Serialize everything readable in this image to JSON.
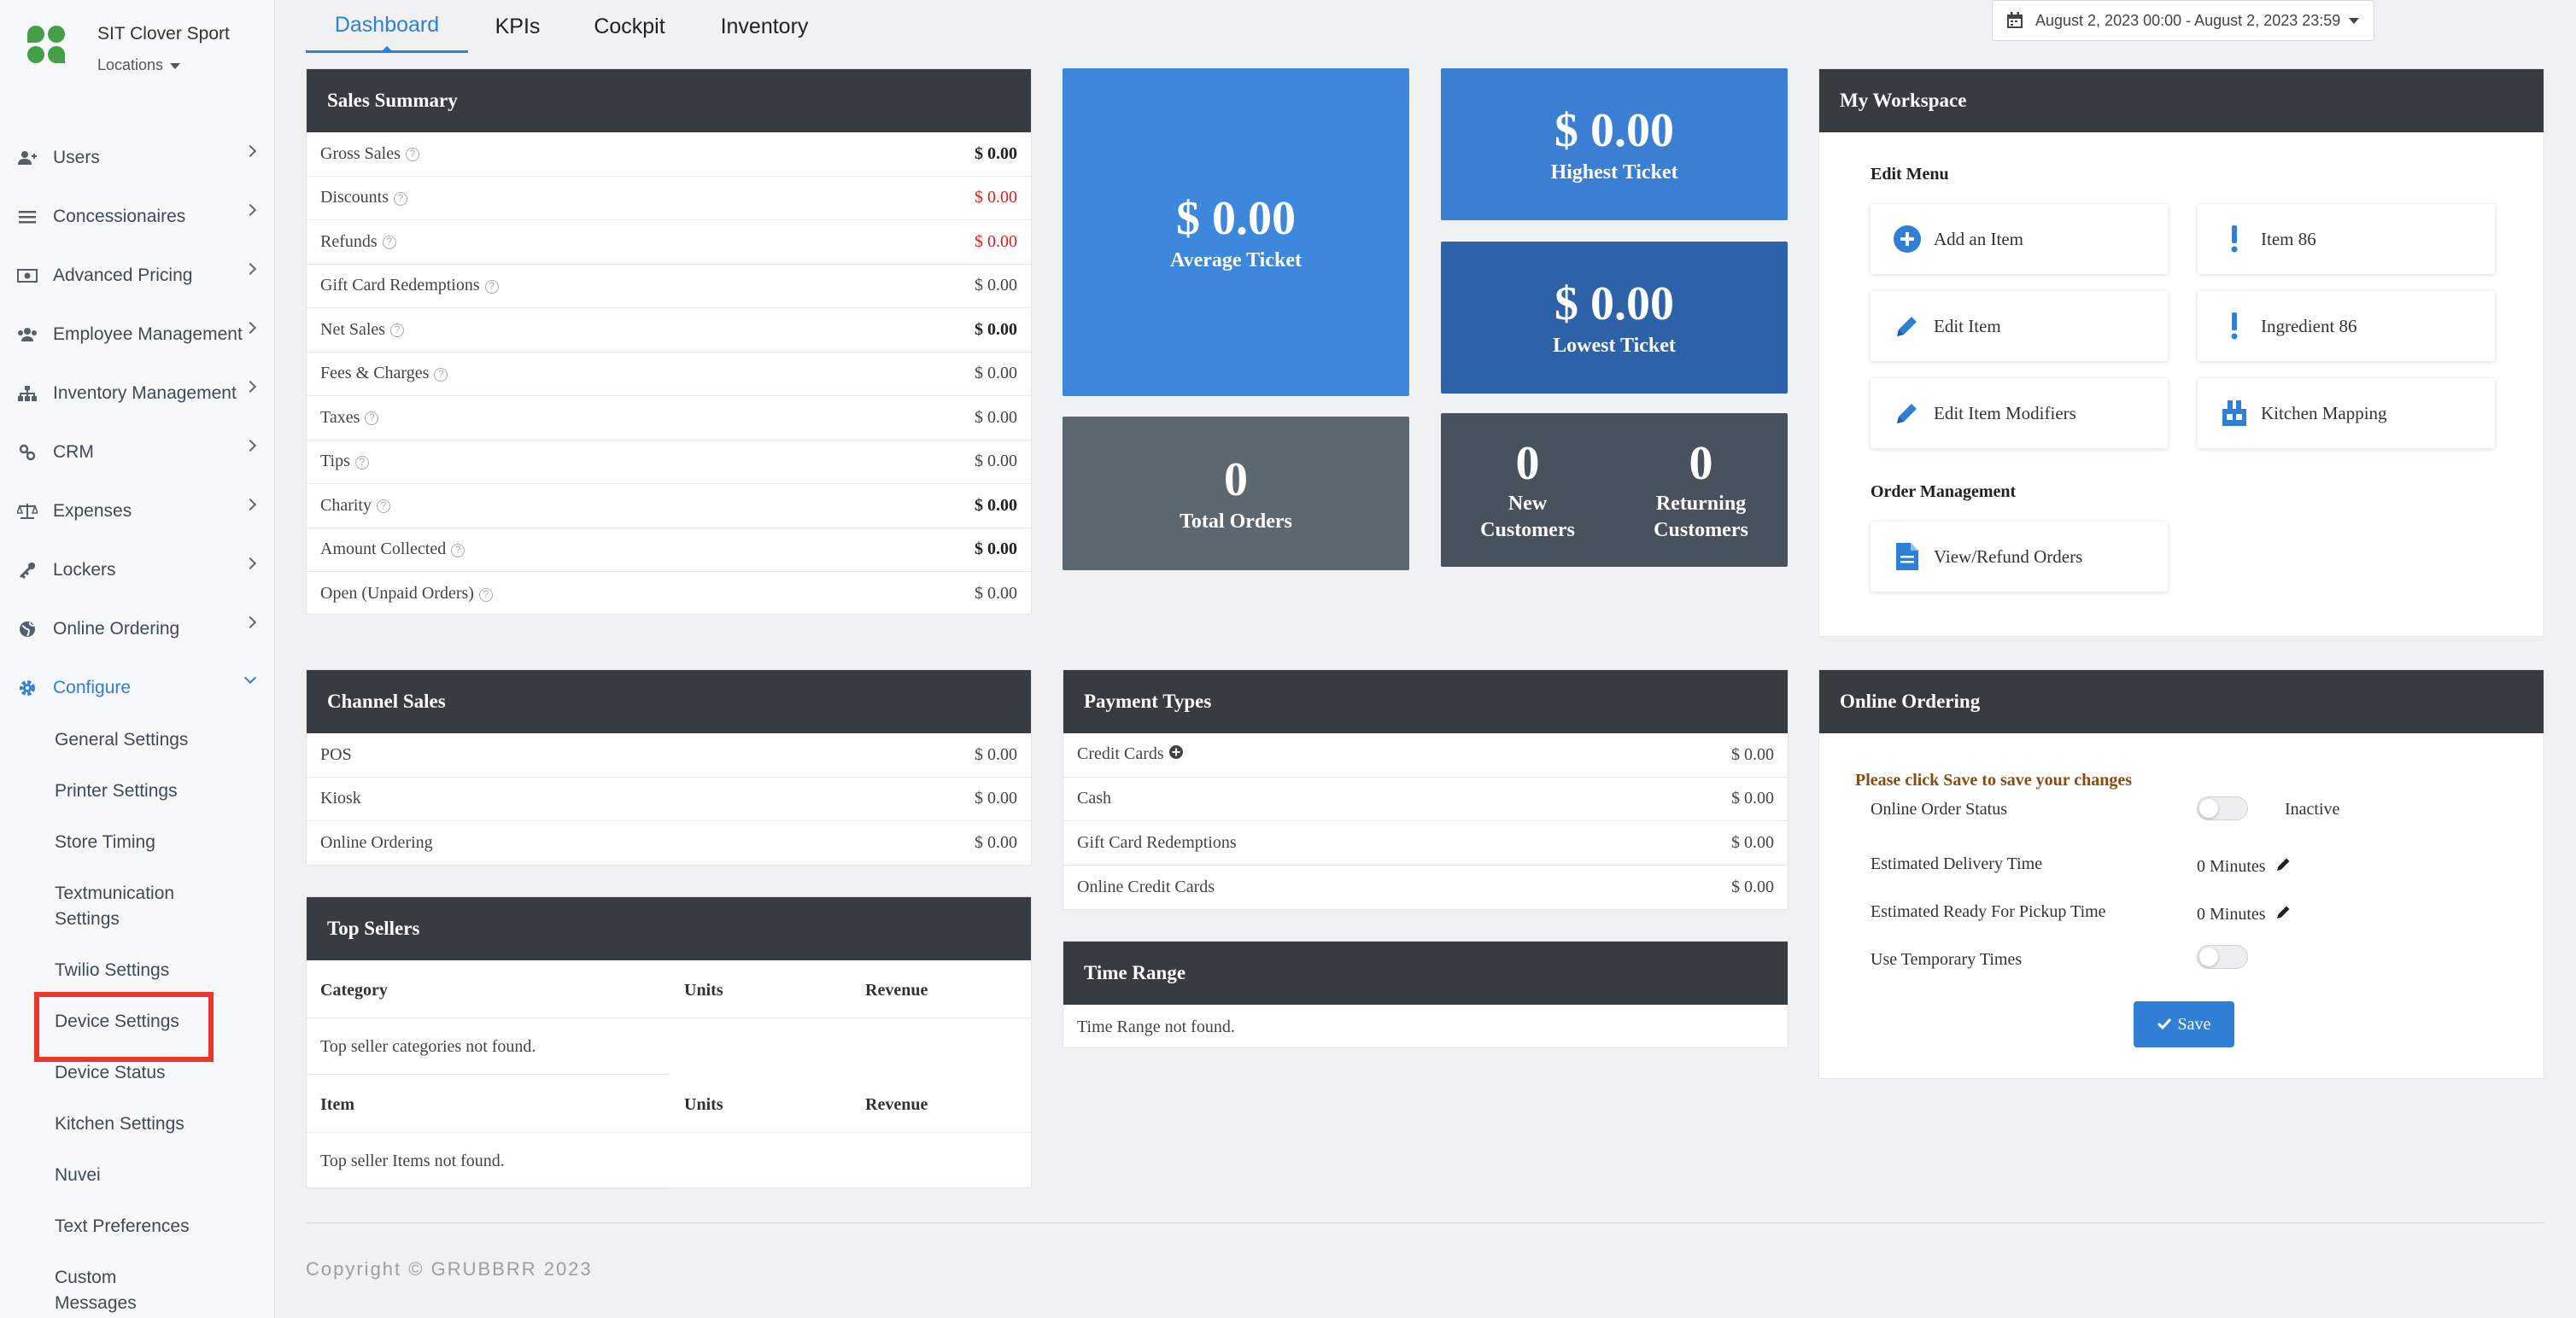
{
  "brand": {
    "store_name": "SIT Clover Sport",
    "locations_label": "Locations"
  },
  "sidebar": {
    "items": [
      {
        "label": "Users",
        "icon": "user-plus-icon"
      },
      {
        "label": "Concessionaires",
        "icon": "list-icon"
      },
      {
        "label": "Advanced Pricing",
        "icon": "money-icon"
      },
      {
        "label": "Employee Management",
        "icon": "users-icon"
      },
      {
        "label": "Inventory Management",
        "icon": "sitemap-icon"
      },
      {
        "label": "CRM",
        "icon": "link-icon"
      },
      {
        "label": "Expenses",
        "icon": "scale-icon"
      },
      {
        "label": "Lockers",
        "icon": "lock-icon"
      },
      {
        "label": "Online Ordering",
        "icon": "globe-icon"
      },
      {
        "label": "Configure",
        "icon": "gear-icon"
      }
    ],
    "configure_sub": [
      "General Settings",
      "Printer Settings",
      "Store Timing",
      "Textmunication Settings",
      "Twilio Settings",
      "Device Settings",
      "Device Status",
      "Kitchen Settings",
      "Nuvei",
      "Text Preferences",
      "Custom Messages"
    ]
  },
  "tabs": [
    "Dashboard",
    "KPIs",
    "Cockpit",
    "Inventory"
  ],
  "date_range": "August 2, 2023 00:00 - August 2, 2023 23:59",
  "sales_summary": {
    "title": "Sales Summary",
    "rows": [
      {
        "label": "Gross Sales",
        "value": "$ 0.00"
      },
      {
        "label": "Discounts",
        "value": "$ 0.00"
      },
      {
        "label": "Refunds",
        "value": "$ 0.00"
      },
      {
        "label": "Gift Card Redemptions",
        "value": "$ 0.00"
      },
      {
        "label": "Net Sales",
        "value": "$ 0.00"
      },
      {
        "label": "Fees & Charges",
        "value": "$ 0.00"
      },
      {
        "label": "Taxes",
        "value": "$ 0.00"
      },
      {
        "label": "Tips",
        "value": "$ 0.00"
      },
      {
        "label": "Charity",
        "value": "$ 0.00"
      },
      {
        "label": "Amount Collected",
        "value": "$ 0.00"
      },
      {
        "label": "Open (Unpaid Orders)",
        "value": "$ 0.00"
      }
    ]
  },
  "tiles": {
    "average_ticket": {
      "value": "$ 0.00",
      "label": "Average Ticket"
    },
    "highest_ticket": {
      "value": "$ 0.00",
      "label": "Highest Ticket"
    },
    "lowest_ticket": {
      "value": "$ 0.00",
      "label": "Lowest Ticket"
    },
    "total_orders": {
      "value": "0",
      "label": "Total Orders"
    },
    "new_customers": {
      "value": "0",
      "label_line1": "New",
      "label_line2": "Customers"
    },
    "returning_customers": {
      "value": "0",
      "label_line1": "Returning",
      "label_line2": "Customers"
    }
  },
  "workspace": {
    "title": "My Workspace",
    "edit_menu_title": "Edit Menu",
    "buttons": {
      "add_item": "Add an Item",
      "item_86": "Item 86",
      "edit_item": "Edit Item",
      "ingredient_86": "Ingredient 86",
      "edit_item_modifiers": "Edit Item Modifiers",
      "kitchen_mapping": "Kitchen Mapping",
      "view_refund_orders": "View/Refund Orders"
    },
    "order_management_title": "Order Management"
  },
  "channel_sales": {
    "title": "Channel Sales",
    "rows": [
      {
        "label": "POS",
        "value": "$ 0.00"
      },
      {
        "label": "Kiosk",
        "value": "$ 0.00"
      },
      {
        "label": "Online Ordering",
        "value": "$ 0.00"
      }
    ]
  },
  "payment_types": {
    "title": "Payment Types",
    "rows": [
      {
        "label": "Credit Cards",
        "value": "$ 0.00"
      },
      {
        "label": "Cash",
        "value": "$ 0.00"
      },
      {
        "label": "Gift Card Redemptions",
        "value": "$ 0.00"
      },
      {
        "label": "Online Credit Cards",
        "value": "$ 0.00"
      }
    ]
  },
  "online_ordering": {
    "title": "Online Ordering",
    "note": "Please click Save to save your changes",
    "status_label": "Online Order Status",
    "status_value": "Inactive",
    "delivery_label": "Estimated Delivery Time",
    "delivery_value": "0 Minutes",
    "pickup_label": "Estimated Ready For Pickup Time",
    "pickup_value": "0 Minutes",
    "temp_label": "Use Temporary Times",
    "save_label": "Save"
  },
  "top_sellers": {
    "title": "Top Sellers",
    "category_header": [
      "Category",
      "Units",
      "Revenue"
    ],
    "category_empty": "Top seller categories not found.",
    "item_header": [
      "Item",
      "Units",
      "Revenue"
    ],
    "item_empty": "Top seller Items not found."
  },
  "time_range": {
    "title": "Time Range",
    "empty": "Time Range not found."
  },
  "footer": {
    "copyright": "Copyright © GRUBBRR 2023"
  },
  "colors": {
    "accent": "#2f7fd6",
    "panel_head": "#373b42",
    "tile_blue": "#3d87dc",
    "tile_navy": "#2d62a8",
    "tile_gray": "#5d6770",
    "tile_dark": "#47525c",
    "negative": "#d62020",
    "highlight_box": "#e6392b"
  }
}
